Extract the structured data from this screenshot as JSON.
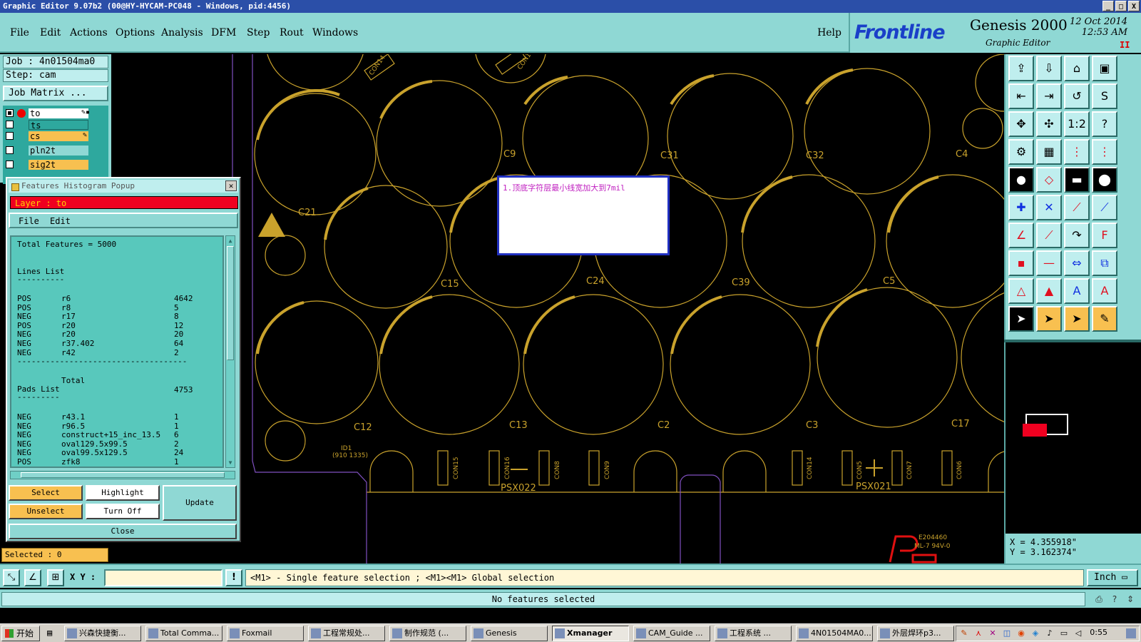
{
  "window": {
    "title": "Graphic Editor 9.07b2 (00@HY-HYCAM-PC048 - Windows, pid:4456)",
    "controls": [
      "_",
      "□",
      "X"
    ]
  },
  "menu": {
    "items": [
      "File",
      "Edit",
      "Actions",
      "Options",
      "Analysis",
      "DFM",
      "Step",
      "Rout",
      "Windows"
    ],
    "help": "Help"
  },
  "brand": {
    "logo": "Frontline",
    "product": "Genesis 2000",
    "subtitle": "Graphic Editor",
    "date": "12 Oct 2014",
    "time": "12:53 AM",
    "pause_glyph": "II"
  },
  "left": {
    "job": "Job : 4n01504ma0",
    "step": "Step: cam",
    "job_matrix": "Job Matrix ...",
    "layers": [
      {
        "name": "to",
        "color": "#ffffff",
        "checked": true,
        "dot": true,
        "mark": "✎▪"
      },
      {
        "name": "ts",
        "color": "#2ea89e",
        "checked": false,
        "dot": false,
        "mark": ""
      },
      {
        "name": "cs",
        "color": "#f8c050",
        "checked": false,
        "dot": false,
        "mark": "✎"
      },
      {
        "name": "pln2t",
        "color": "#8fd8d4",
        "checked": false,
        "dot": false,
        "mark": ""
      },
      {
        "name": "sig2t",
        "color": "#f8c050",
        "checked": false,
        "dot": false,
        "mark": ""
      }
    ]
  },
  "popup": {
    "title": "Features Histogram Popup",
    "close_glyph": "✕",
    "layer": "Layer :  to",
    "menu": [
      "File",
      "Edit"
    ],
    "total": "Total Features = 5000",
    "lines_heading": "Lines List",
    "lines_rule": "----------",
    "lines": [
      [
        "POS",
        "r6",
        "4642"
      ],
      [
        "POS",
        "r8",
        "5"
      ],
      [
        "NEG",
        "r17",
        "8"
      ],
      [
        "POS",
        "r20",
        "12"
      ],
      [
        "NEG",
        "r20",
        "20"
      ],
      [
        "NEG",
        "r37.402",
        "64"
      ],
      [
        "NEG",
        "r42",
        "2"
      ]
    ],
    "total_rule": "------------------------------------",
    "lines_total_label": "Total",
    "lines_total": "4753",
    "pads_heading": "Pads List",
    "pads_rule": "---------",
    "pads": [
      [
        "NEG",
        "r43.1",
        "1"
      ],
      [
        "NEG",
        "r96.5",
        "1"
      ],
      [
        "NEG",
        "construct+15_inc_13.5",
        "6"
      ],
      [
        "NEG",
        "oval129.5x99.5",
        "2"
      ],
      [
        "NEG",
        "oval99.5x129.5",
        "24"
      ],
      [
        "POS",
        "zfk8",
        "1"
      ]
    ],
    "buttons": {
      "select": "Select",
      "highlight": "Highlight",
      "update": "Update",
      "unselect": "Unselect",
      "turn_off": "Turn Off",
      "close": "Close"
    }
  },
  "selected": "Selected : 0",
  "note": "1.顶底字符层最小线宽加大到7mil",
  "canvas": {
    "refs": [
      "C21",
      "C9",
      "C31",
      "C32",
      "C4",
      "C15",
      "C24",
      "C39",
      "C5",
      "C12",
      "C13",
      "C2",
      "C3",
      "C17",
      "PSX022",
      "PSX021"
    ],
    "small_refs": [
      "CON14",
      "CON18",
      "CON15",
      "CON16",
      "CON8",
      "CON9",
      "CON14",
      "CON5",
      "CON7",
      "CON6"
    ],
    "id_text": "ID1",
    "id_coord": "(910 1335)",
    "ul_text": "E204460",
    "ul_text2": "ML-7 94V-0"
  },
  "coords": {
    "x": "X = 4.355918\"",
    "y": "Y = 3.162374\""
  },
  "command": {
    "xy_label": "X Y :",
    "xy_value": "",
    "warn": "!",
    "hint": "<M1> - Single feature selection ; <M1><M1> Global selection",
    "unit": "Inch ▭"
  },
  "status": "No features selected",
  "taskbar": {
    "start": "开始",
    "tasks": [
      "兴森快捷衡...",
      "Total Comma...",
      "Foxmail",
      "工程常规处...",
      "制作规范 (...",
      "Genesis",
      "Xmanager",
      "CAM_Guide ...",
      "工程系统 ...",
      "4N01504MA0...",
      "外层焊环p3..."
    ],
    "clock": "0:55"
  },
  "colors": {
    "teal": "#8fd8d4",
    "gold": "#c9a22c",
    "red_layer": "#f00020"
  }
}
